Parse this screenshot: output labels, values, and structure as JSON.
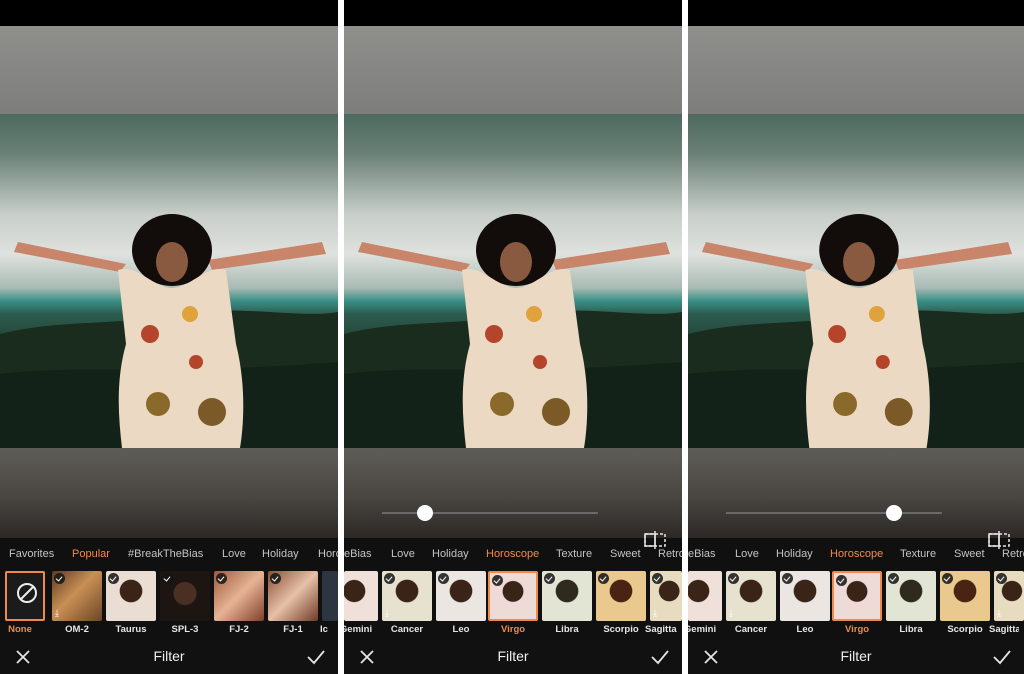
{
  "screen_title": "Filter",
  "colors": {
    "accent": "#f08a4b",
    "bar_bg": "#111111"
  },
  "icons": {
    "close": "close-icon",
    "confirm": "checkmark-icon",
    "compare": "compare-icon",
    "none": "none-icon",
    "selected": "check-badge-icon",
    "download": "download-icon"
  },
  "panel1": {
    "tabs": [
      "Favorites",
      "Popular",
      "#BreakTheBias",
      "Love",
      "Holiday",
      "Horos"
    ],
    "active_tab": "Popular",
    "filters": [
      "None",
      "OM-2",
      "Taurus",
      "SPL-3",
      "FJ-2",
      "FJ-1",
      "Ic"
    ],
    "active_filter": "None"
  },
  "panel2": {
    "tabs": [
      "eBias",
      "Love",
      "Holiday",
      "Horoscope",
      "Texture",
      "Sweet",
      "Retro"
    ],
    "active_tab": "Horoscope",
    "filters": [
      "Gemini",
      "Cancer",
      "Leo",
      "Virgo",
      "Libra",
      "Scorpio",
      "Sagitta"
    ],
    "active_filter": "Virgo",
    "slider_level": 0.2
  },
  "panel3": {
    "tabs": [
      "eBias",
      "Love",
      "Holiday",
      "Horoscope",
      "Texture",
      "Sweet",
      "Retro"
    ],
    "active_tab": "Horoscope",
    "filters": [
      "Gemini",
      "Cancer",
      "Leo",
      "Virgo",
      "Libra",
      "Scorpio",
      "Sagitta"
    ],
    "active_filter": "Virgo",
    "slider_level": 0.78
  }
}
